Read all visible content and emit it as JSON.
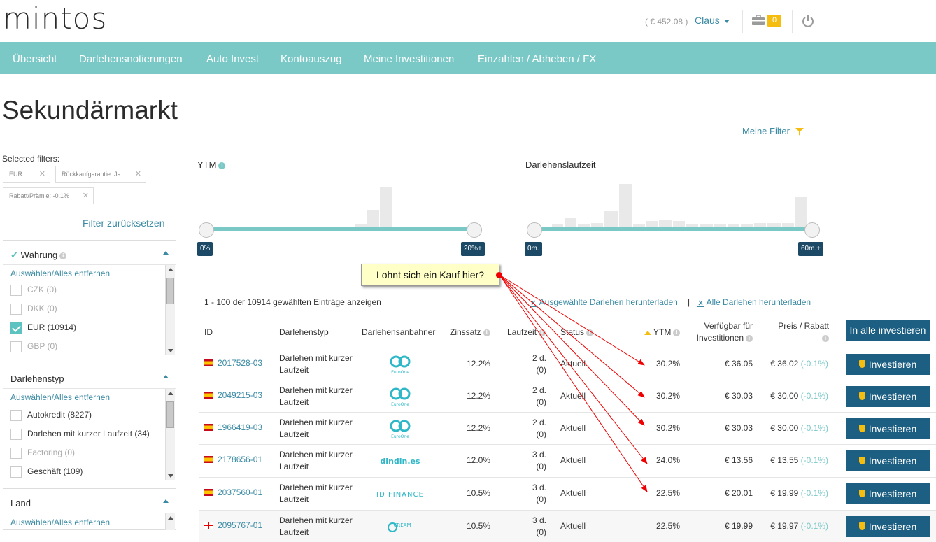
{
  "header": {
    "logo": "mintos",
    "balance": "( € 452.08 )",
    "user": "Claus",
    "cart_count": "0"
  },
  "nav": [
    "Übersicht",
    "Darlehensnotierungen",
    "Auto Invest",
    "Kontoauszug",
    "Meine Investitionen",
    "Einzahlen / Abheben / FX"
  ],
  "page": {
    "title": "Sekundärmarkt",
    "my_filter": "Meine Filter"
  },
  "filters": {
    "selected_label": "Selected filters:",
    "chips": [
      "EUR",
      "Rückkaufgarantie: Ja",
      "Rabatt/Prämie: -0.1%"
    ],
    "reset": "Filter zurücksetzen",
    "select_all": "Auswählen/Alles entfernen",
    "currency": {
      "title": "Währung",
      "options": [
        {
          "label": "CZK (0)",
          "checked": false,
          "disabled": true
        },
        {
          "label": "DKK (0)",
          "checked": false,
          "disabled": true
        },
        {
          "label": "EUR (10914)",
          "checked": true,
          "disabled": false
        },
        {
          "label": "GBP (0)",
          "checked": false,
          "disabled": true
        }
      ]
    },
    "loan_type": {
      "title": "Darlehenstyp",
      "options": [
        {
          "label": "Autokredit (8227)",
          "checked": false,
          "disabled": false
        },
        {
          "label": "Darlehen mit kurzer Laufzeit (34)",
          "checked": false,
          "disabled": false
        },
        {
          "label": "Factoring (0)",
          "checked": false,
          "disabled": true
        },
        {
          "label": "Geschäft (109)",
          "checked": false,
          "disabled": false
        }
      ]
    },
    "country": {
      "title": "Land"
    }
  },
  "sliders": {
    "ytm": {
      "label": "YTM",
      "min": "0%",
      "max": "20%+"
    },
    "term": {
      "label": "Darlehenslaufzeit",
      "min": "0m.",
      "max": "60m.+"
    }
  },
  "callout": "Lohnt sich ein Kauf hier?",
  "table": {
    "count": "1 - 100 der 10914 gewählten Einträge anzeigen",
    "download_selected": "Ausgewählte Darlehen herunterladen",
    "download_all": "Alle Darlehen herunterladen",
    "separator": "|",
    "headers": {
      "id": "ID",
      "type": "Darlehenstyp",
      "originator": "Darlehensanbahner",
      "rate": "Zinssatz",
      "term": "Laufzeit",
      "status": "Status",
      "ytm": "YTM",
      "avail": "Verfügbar für Investitionen",
      "price": "Preis / Rabatt"
    },
    "invest_all": "In alle investieren",
    "invest_label": "Investieren",
    "rows": [
      {
        "id": "2017528-03",
        "type": "Darlehen mit kurzer Laufzeit",
        "originator": "EuroOne",
        "rate": "12.2%",
        "term_a": "2 d.",
        "term_b": "(0)",
        "status": "Aktuell",
        "ytm": "30.2%",
        "avail": "€ 36.05",
        "price": "€ 36.02",
        "disc": "(-0.1%)"
      },
      {
        "id": "2049215-03",
        "type": "Darlehen mit kurzer Laufzeit",
        "originator": "EuroOne",
        "rate": "12.2%",
        "term_a": "2 d.",
        "term_b": "(0)",
        "status": "Aktuell",
        "ytm": "30.2%",
        "avail": "€ 30.03",
        "price": "€ 30.00",
        "disc": "(-0.1%)"
      },
      {
        "id": "1966419-03",
        "type": "Darlehen mit kurzer Laufzeit",
        "originator": "EuroOne",
        "rate": "12.2%",
        "term_a": "2 d.",
        "term_b": "(0)",
        "status": "Aktuell",
        "ytm": "30.2%",
        "avail": "€ 30.03",
        "price": "€ 30.00",
        "disc": "(-0.1%)"
      },
      {
        "id": "2178656-01",
        "type": "Darlehen mit kurzer Laufzeit",
        "originator": "dindin.es",
        "rate": "12.0%",
        "term_a": "3 d.",
        "term_b": "(0)",
        "status": "Aktuell",
        "ytm": "24.0%",
        "avail": "€ 13.56",
        "price": "€ 13.55",
        "disc": "(-0.1%)"
      },
      {
        "id": "2037560-01",
        "type": "Darlehen mit kurzer Laufzeit",
        "originator": "ID FINANCE",
        "rate": "10.5%",
        "term_a": "3 d.",
        "term_b": "(0)",
        "status": "Aktuell",
        "ytm": "22.5%",
        "avail": "€ 20.01",
        "price": "€ 19.99",
        "disc": "(-0.1%)"
      },
      {
        "id": "2095767-01",
        "type": "Darlehen mit kurzer Laufzeit",
        "originator": "CREAM",
        "rate": "10.5%",
        "term_a": "3 d.",
        "term_b": "(0)",
        "status": "Aktuell",
        "ytm": "22.5%",
        "avail": "€ 19.99",
        "price": "€ 19.97",
        "disc": "(-0.1%)"
      }
    ]
  }
}
